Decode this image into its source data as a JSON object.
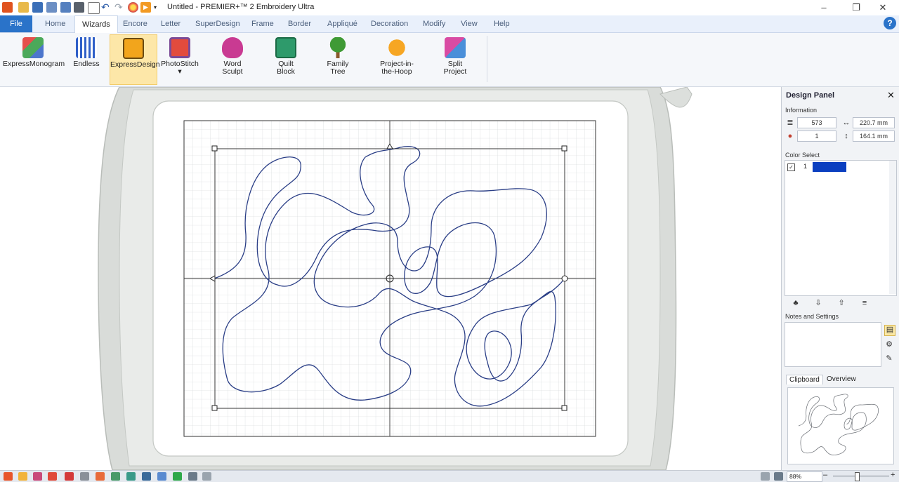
{
  "window": {
    "title": "Untitled - PREMIER+™ 2 Embroidery Ultra",
    "minimize": "–",
    "maximize": "❐",
    "close": "✕"
  },
  "tabs": [
    "File",
    "Home",
    "Wizards",
    "Encore",
    "Letter",
    "SuperDesign",
    "Frame",
    "Border",
    "Appliqué",
    "Decoration",
    "Modify",
    "View",
    "Help"
  ],
  "help_label": "?",
  "ribbon": {
    "buttons": [
      {
        "label": "ExpressMonogram",
        "label2": ""
      },
      {
        "label": "Endless",
        "label2": ""
      },
      {
        "label": "ExpressDesign",
        "label2": ""
      },
      {
        "label": "PhotoStitch",
        "label2": ""
      },
      {
        "label": "Word",
        "label2": "Sculpt"
      },
      {
        "label": "Quilt",
        "label2": "Block"
      },
      {
        "label": "Family",
        "label2": "Tree"
      },
      {
        "label": "Project-in-",
        "label2": "the-Hoop"
      },
      {
        "label": "Split",
        "label2": "Project"
      }
    ],
    "photostitch_arrow": "▾"
  },
  "design_panel": {
    "title": "Design Panel",
    "close": "✕",
    "information_label": "Information",
    "stitches": "573",
    "width": "220.7 mm",
    "colors": "1",
    "height": "164.1 mm",
    "color_select_label": "Color Select",
    "color_item_number": "1",
    "color_item_swatch": "#0b3fc0",
    "notes_label": "Notes and Settings",
    "tab_clipboard": "Clipboard",
    "tab_overview": "Overview"
  },
  "statusbar": {
    "zoom": "88%",
    "zoom_out": "–",
    "zoom_in": "+"
  },
  "colors": {
    "accent": "#2a73c9",
    "design_thread": "#2a3e86",
    "hoop": "#d7dbd8"
  }
}
